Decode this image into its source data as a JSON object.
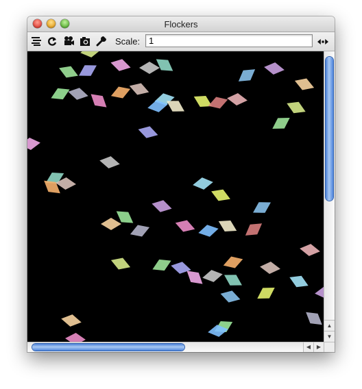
{
  "window": {
    "title": "Flockers"
  },
  "toolbar": {
    "icons": [
      "layers-icon",
      "refresh-icon",
      "movie-camera-icon",
      "snapshot-camera-icon",
      "wrench-icon"
    ],
    "scale_label": "Scale:",
    "scale_value": "1",
    "options_icon": "left-right-arrows-icon"
  },
  "canvas": {
    "background": "#000000",
    "flocker_colors": [
      "#d6e98a",
      "#9ee39a",
      "#a9a8f4",
      "#f0a8e6",
      "#c8c8c8",
      "#8fd7c4",
      "#f6b06c",
      "#d7c0b8",
      "#a2e2f6",
      "#e6f36e",
      "#87c0ea",
      "#c9a0e0",
      "#f7d3a0",
      "#9be59a",
      "#b2b2c9",
      "#ec8dc8",
      "#7fc0ff",
      "#f3eccc",
      "#d77d7d",
      "#eab2b6"
    ]
  },
  "scrollbars": {
    "vertical": {
      "position_fraction": 0.0,
      "visible_fraction": 0.5
    },
    "horizontal": {
      "position_fraction": 0.0,
      "visible_fraction": 0.5
    }
  }
}
